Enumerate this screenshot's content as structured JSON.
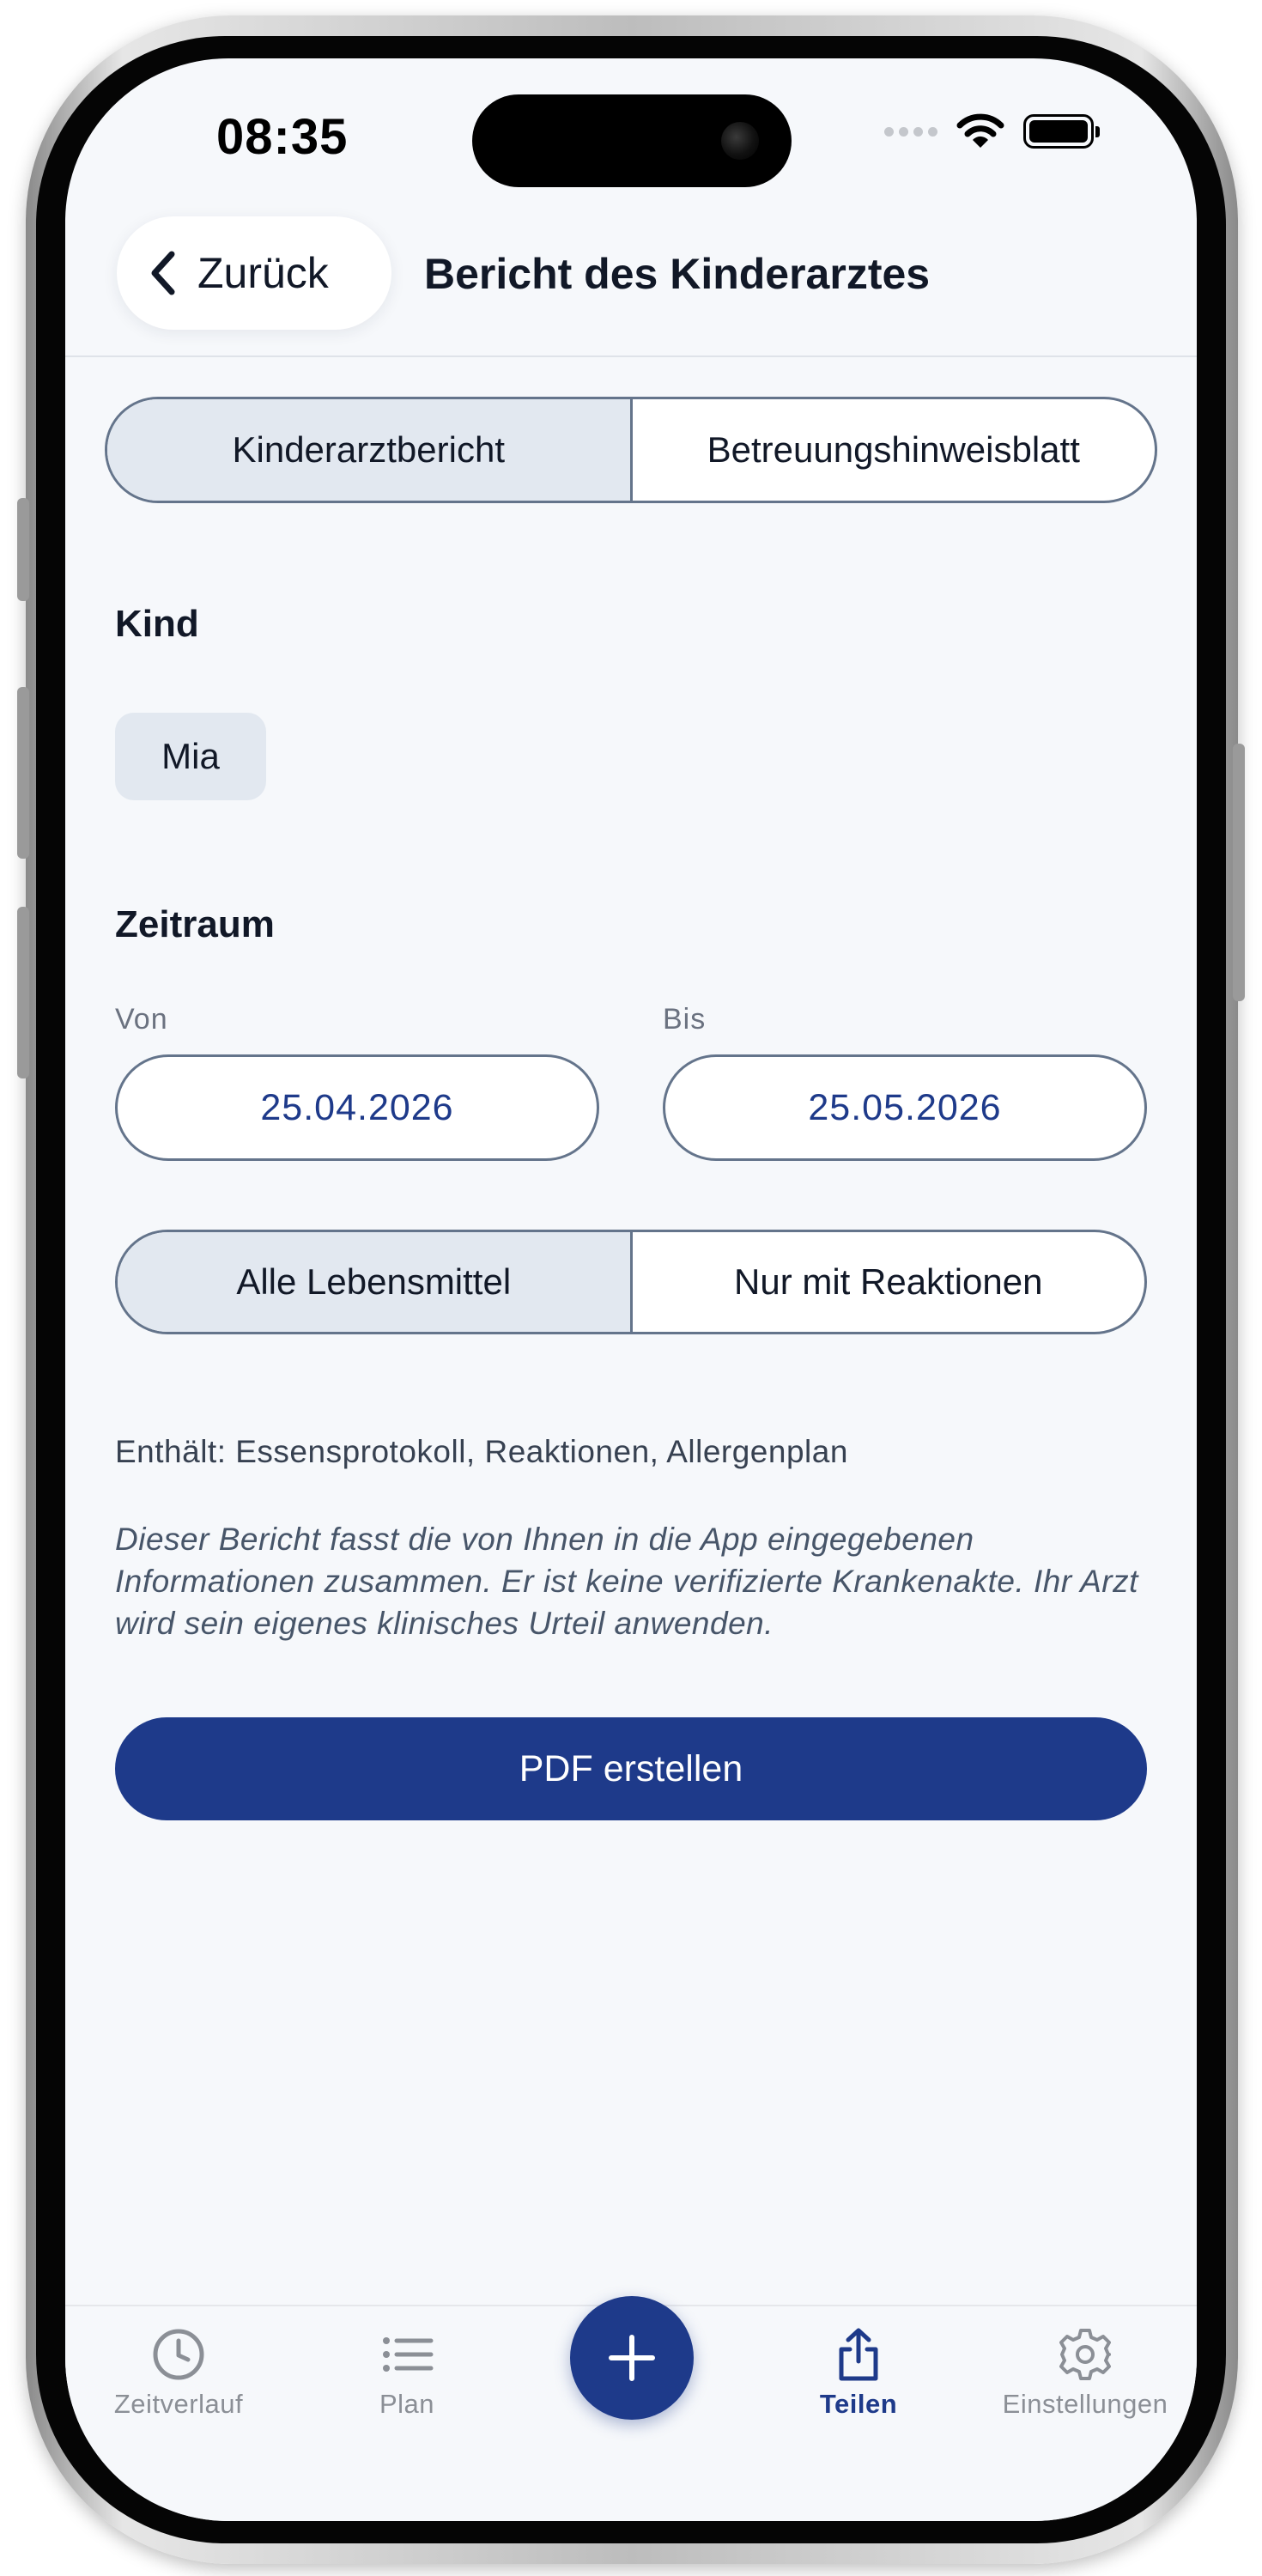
{
  "status_bar": {
    "time": "08:35"
  },
  "header": {
    "back_label": "Zurück",
    "title": "Bericht des Kinderarztes"
  },
  "report_type_tabs": [
    {
      "label": "Kinderarztbericht",
      "active": true
    },
    {
      "label": "Betreuungshinweisblatt",
      "active": false
    }
  ],
  "child_section": {
    "title": "Kind",
    "selected_child": "Mia"
  },
  "period_section": {
    "title": "Zeitraum",
    "from_label": "Von",
    "from_value": "25.04.2026",
    "to_label": "Bis",
    "to_value": "25.05.2026"
  },
  "food_filter": [
    {
      "label": "Alle Lebensmittel",
      "active": true
    },
    {
      "label": "Nur mit Reaktionen",
      "active": false
    }
  ],
  "contains_text": "Enthält: Essensprotokoll, Reaktionen, Allergenplan",
  "disclaimer": "Dieser Bericht fasst die von Ihnen in die App eingegebenen Informationen zusammen. Er ist keine verifizierte Krankenakte. Ihr Arzt wird sein eigenes klinisches Urteil anwenden.",
  "primary_action": {
    "label": "PDF erstellen"
  },
  "tab_bar": {
    "items": [
      {
        "label": "Zeitverlauf",
        "icon": "clock-icon"
      },
      {
        "label": "Plan",
        "icon": "list-icon"
      },
      {
        "label": "Teilen",
        "icon": "share-icon",
        "active": true
      },
      {
        "label": "Einstellungen",
        "icon": "gear-icon"
      }
    ],
    "fab_icon": "plus-icon"
  },
  "colors": {
    "accent": "#1e3a8a",
    "segment_active": "#e2e8f0",
    "border": "#64748b",
    "background": "#f6f8fb"
  }
}
